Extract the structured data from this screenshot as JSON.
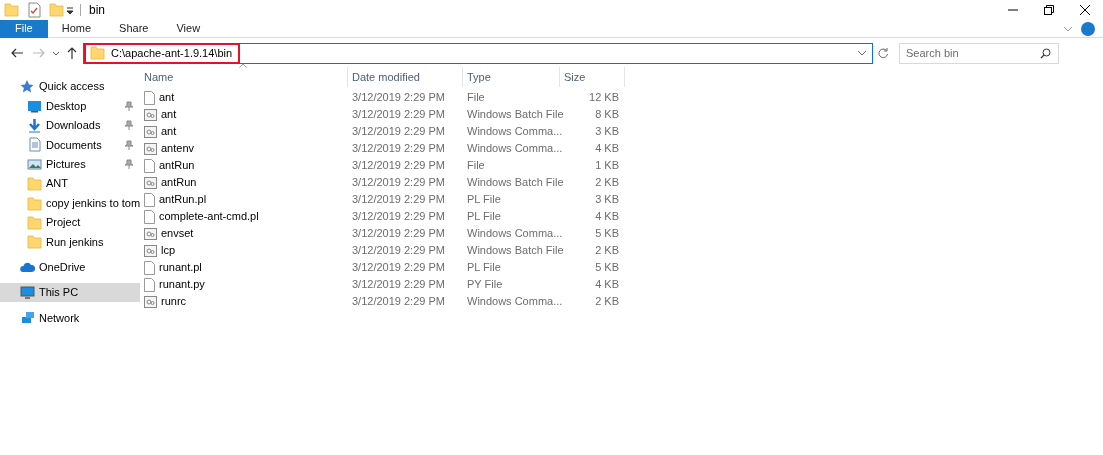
{
  "window": {
    "title": "bin"
  },
  "ribbon": {
    "tabs": [
      {
        "label": "File",
        "selected": true
      },
      {
        "label": "Home",
        "selected": false
      },
      {
        "label": "Share",
        "selected": false
      },
      {
        "label": "View",
        "selected": false
      }
    ]
  },
  "address_bar": {
    "path": "C:\\apache-ant-1.9.14\\bin",
    "highlighted": true
  },
  "search": {
    "placeholder": "Search bin"
  },
  "sidebar": {
    "items": [
      {
        "label": "Quick access",
        "kind": "star",
        "selected": false,
        "children": [
          {
            "label": "Desktop",
            "kind": "desktop",
            "pinned": true
          },
          {
            "label": "Downloads",
            "kind": "download",
            "pinned": true
          },
          {
            "label": "Documents",
            "kind": "document",
            "pinned": true
          },
          {
            "label": "Pictures",
            "kind": "pictures",
            "pinned": true
          },
          {
            "label": "ANT",
            "kind": "folder",
            "pinned": false
          },
          {
            "label": "copy jenkins to tom",
            "kind": "folder",
            "pinned": false
          },
          {
            "label": "Project",
            "kind": "folder",
            "pinned": false
          },
          {
            "label": "Run jenkins",
            "kind": "folder",
            "pinned": false
          }
        ]
      },
      {
        "label": "OneDrive",
        "kind": "cloud",
        "selected": false
      },
      {
        "label": "This PC",
        "kind": "computer",
        "selected": true
      },
      {
        "label": "Network",
        "kind": "network",
        "selected": false
      }
    ]
  },
  "table": {
    "columns": [
      "Name",
      "Date modified",
      "Type",
      "Size"
    ],
    "rows": [
      {
        "kind": "file",
        "name": "ant",
        "date": "3/12/2019 2:29 PM",
        "type": "File",
        "size": "12 KB"
      },
      {
        "kind": "script",
        "name": "ant",
        "date": "3/12/2019 2:29 PM",
        "type": "Windows Batch File",
        "size": "8 KB"
      },
      {
        "kind": "script",
        "name": "ant",
        "date": "3/12/2019 2:29 PM",
        "type": "Windows Comma...",
        "size": "3 KB"
      },
      {
        "kind": "script",
        "name": "antenv",
        "date": "3/12/2019 2:29 PM",
        "type": "Windows Comma...",
        "size": "4 KB"
      },
      {
        "kind": "file",
        "name": "antRun",
        "date": "3/12/2019 2:29 PM",
        "type": "File",
        "size": "1 KB"
      },
      {
        "kind": "script",
        "name": "antRun",
        "date": "3/12/2019 2:29 PM",
        "type": "Windows Batch File",
        "size": "2 KB"
      },
      {
        "kind": "file",
        "name": "antRun.pl",
        "date": "3/12/2019 2:29 PM",
        "type": "PL File",
        "size": "3 KB"
      },
      {
        "kind": "file",
        "name": "complete-ant-cmd.pl",
        "date": "3/12/2019 2:29 PM",
        "type": "PL File",
        "size": "4 KB"
      },
      {
        "kind": "script",
        "name": "envset",
        "date": "3/12/2019 2:29 PM",
        "type": "Windows Comma...",
        "size": "5 KB"
      },
      {
        "kind": "script",
        "name": "lcp",
        "date": "3/12/2019 2:29 PM",
        "type": "Windows Batch File",
        "size": "2 KB"
      },
      {
        "kind": "file",
        "name": "runant.pl",
        "date": "3/12/2019 2:29 PM",
        "type": "PL File",
        "size": "5 KB"
      },
      {
        "kind": "file",
        "name": "runant.py",
        "date": "3/12/2019 2:29 PM",
        "type": "PY File",
        "size": "4 KB"
      },
      {
        "kind": "script",
        "name": "runrc",
        "date": "3/12/2019 2:29 PM",
        "type": "Windows Comma...",
        "size": "2 KB"
      }
    ]
  }
}
